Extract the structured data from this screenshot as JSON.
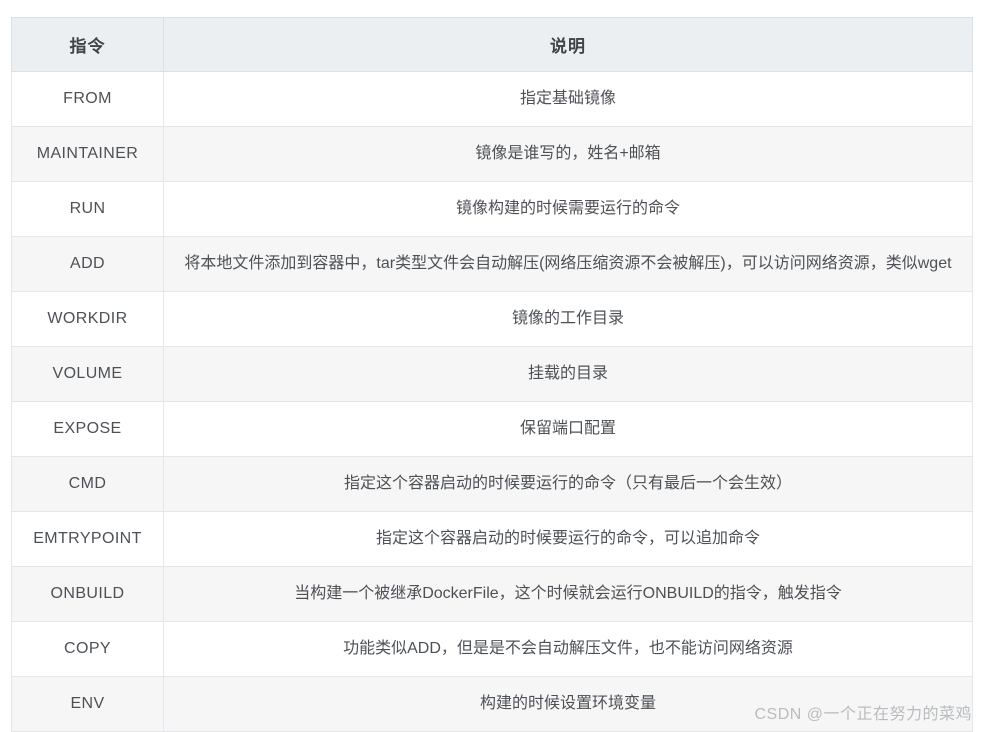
{
  "table": {
    "headers": {
      "command": "指令",
      "description": "说明"
    },
    "rows": [
      {
        "command": "FROM",
        "description": "指定基础镜像"
      },
      {
        "command": "MAINTAINER",
        "description": "镜像是谁写的，姓名+邮箱"
      },
      {
        "command": "RUN",
        "description": "镜像构建的时候需要运行的命令"
      },
      {
        "command": "ADD",
        "description": "将本地文件添加到容器中，tar类型文件会自动解压(网络压缩资源不会被解压)，可以访问网络资源，类似wget"
      },
      {
        "command": "WORKDIR",
        "description": "镜像的工作目录"
      },
      {
        "command": "VOLUME",
        "description": "挂载的目录"
      },
      {
        "command": "EXPOSE",
        "description": "保留端口配置"
      },
      {
        "command": "CMD",
        "description": "指定这个容器启动的时候要运行的命令（只有最后一个会生效）"
      },
      {
        "command": "EMTRYPOINT",
        "description": "指定这个容器启动的时候要运行的命令，可以追加命令"
      },
      {
        "command": "ONBUILD",
        "description": "当构建一个被继承DockerFile，这个时候就会运行ONBUILD的指令，触发指令"
      },
      {
        "command": "COPY",
        "description": "功能类似ADD，但是是不会自动解压文件，也不能访问网络资源"
      },
      {
        "command": "ENV",
        "description": "构建的时候设置环境变量"
      }
    ]
  },
  "watermark": {
    "text": "CSDN @一个正在努力的菜鸡"
  },
  "colors": {
    "header_background": "#eceff1",
    "header_text": "#3f4448",
    "body_text": "#4d5156",
    "row_stripe": "#f6f6f6",
    "border": "#e4e7ea",
    "watermark_text": "#b9bcbf"
  }
}
